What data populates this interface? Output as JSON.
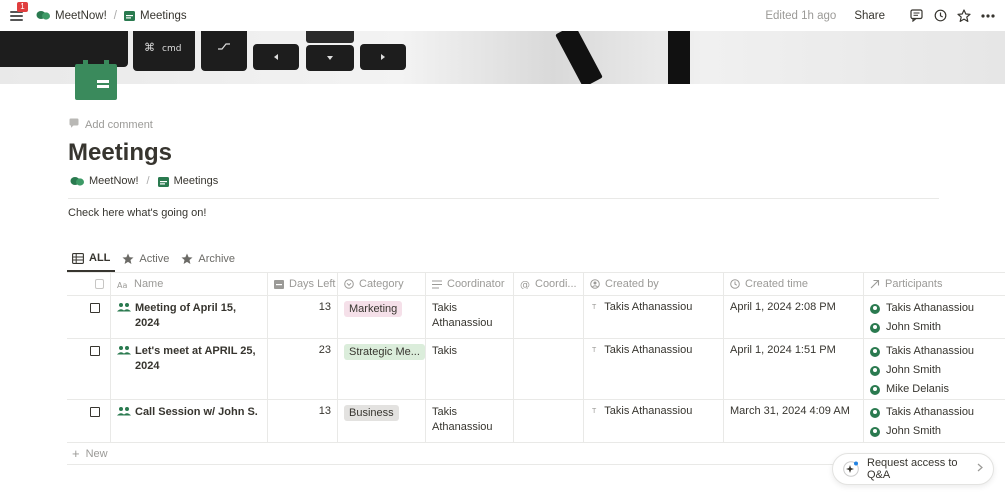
{
  "topbar": {
    "notification_count": "1",
    "breadcrumb": [
      {
        "label": "MeetNow!",
        "icon": "speech-bubbles-icon"
      },
      {
        "label": "Meetings",
        "icon": "calendar-icon"
      }
    ],
    "separator": "/",
    "edited": "Edited 1h ago",
    "share": "Share"
  },
  "page": {
    "add_comment": "Add comment",
    "title": "Meetings",
    "breadcrumb": [
      {
        "label": "MeetNow!"
      },
      {
        "label": "Meetings"
      }
    ],
    "separator": "/",
    "description": "Check here what's going on!"
  },
  "tabs": [
    {
      "label": "ALL",
      "icon": "table-icon",
      "active": true
    },
    {
      "label": "Active",
      "icon": "star-icon",
      "active": false
    },
    {
      "label": "Archive",
      "icon": "star-icon",
      "active": false
    }
  ],
  "table": {
    "headers": {
      "name": "Name",
      "days_left": "Days Left",
      "category": "Category",
      "coordinator": "Coordinator",
      "coordinator2": "Coordi...",
      "created_by": "Created by",
      "created_time": "Created time",
      "participants": "Participants"
    },
    "rows": [
      {
        "name": "Meeting of April 15, 2024",
        "days_left": "13",
        "category": "Marketing",
        "category_color": "#f5e0e9",
        "coordinator": "Takis Athanassiou",
        "created_by_initial": "T",
        "created_by": "Takis Athanassiou",
        "created_time": "April 1, 2024 2:08 PM",
        "participants": [
          "Takis Athanassiou",
          "John Smith"
        ]
      },
      {
        "name": "Let's meet at APRIL 25, 2024",
        "days_left": "23",
        "category": "Strategic Me...",
        "category_color": "#dbeddb",
        "coordinator": "Takis",
        "created_by_initial": "T",
        "created_by": "Takis Athanassiou",
        "created_time": "April 1, 2024 1:51 PM",
        "participants": [
          "Takis Athanassiou",
          "John Smith",
          "Mike Delanis"
        ]
      },
      {
        "name": "Call Session w/ John S.",
        "days_left": "13",
        "category": "Business",
        "category_color": "#e3e2e0",
        "coordinator": "Takis Athanassiou",
        "created_by_initial": "T",
        "created_by": "Takis Athanassiou",
        "created_time": "March 31, 2024 4:09 AM",
        "participants": [
          "Takis Athanassiou",
          "John Smith"
        ]
      }
    ],
    "new_label": "New"
  },
  "request_access": "Request access to Q&A",
  "colors": {
    "accent_green": "#2a7a4f",
    "text": "#37352f",
    "muted": "#9b9a97"
  }
}
